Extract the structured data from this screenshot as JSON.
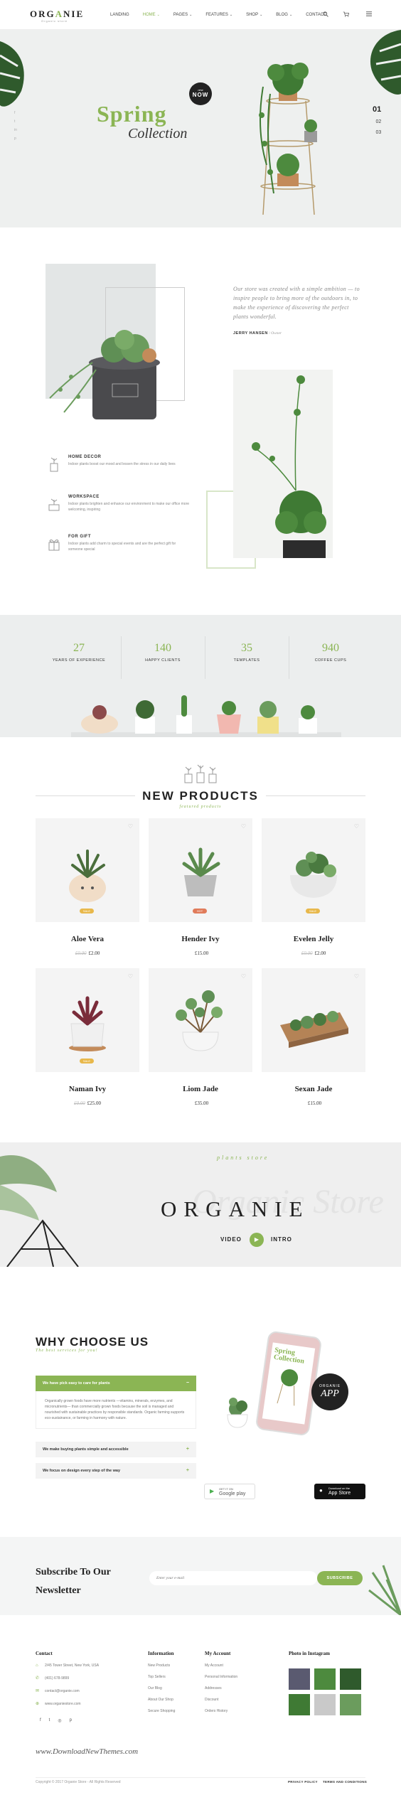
{
  "header": {
    "logo": "ORGANIE",
    "logo_sub": "Organic store",
    "nav": [
      {
        "label": "LANDING",
        "caret": ""
      },
      {
        "label": "HOME",
        "caret": "⌄"
      },
      {
        "label": "PAGES",
        "caret": "⌄"
      },
      {
        "label": "FEATURES",
        "caret": "⌄"
      },
      {
        "label": "SHOP",
        "caret": "⌄"
      },
      {
        "label": "BLOG",
        "caret": "⌄"
      },
      {
        "label": "CONTACT",
        "caret": ""
      }
    ],
    "search_icon": "⌕",
    "cart_icon": "🛒",
    "menu_icon": "≡"
  },
  "hero": {
    "title": "Spring",
    "subtitle": "Collection",
    "badge_small": "new",
    "badge_big": "NOW",
    "slides": [
      "01",
      "02",
      "03"
    ],
    "social": [
      "f",
      "t",
      "in",
      "p"
    ]
  },
  "about": {
    "quote": "Our store was created with a simple ambition — to inspire people to bring more of the outdoors in, to make the experience of discovering the perfect plants wonderful.",
    "author_name": "JERRY HANSEN",
    "author_role": " / Owner",
    "features": [
      {
        "title": "HOME DECOR",
        "text": "Indoor plants boost our mood and lessen the stress in our daily lives"
      },
      {
        "title": "WORKSPACE",
        "text": "Indoor plants brighten and enhance our environment to make our office more welcoming, inspiring"
      },
      {
        "title": "FOR GIFT",
        "text": "Indoor plants add charm to special events and are the perfect gift for someone special"
      }
    ]
  },
  "stats": [
    {
      "num": "27",
      "label": "YEARS OF EXPERIENCE"
    },
    {
      "num": "140",
      "label": "HAPPY CLIENTS"
    },
    {
      "num": "35",
      "label": "TEMPLATES"
    },
    {
      "num": "940",
      "label": "COFFEE CUPS"
    }
  ],
  "products_section": {
    "title": "NEW PRODUCTS",
    "subtitle": "featured products",
    "items": [
      {
        "name": "Aloe Vera",
        "old_price": "£0.00",
        "price": "£2.00",
        "badge": "SALE",
        "badge_color": "#e8b84b"
      },
      {
        "name": "Hender Ivy",
        "old_price": "",
        "price": "£15.00",
        "badge": "HOT",
        "badge_color": "#e07b5a"
      },
      {
        "name": "Evelen Jelly",
        "old_price": "£0.00",
        "price": "£2.00",
        "badge": "SALE",
        "badge_color": "#e8b84b"
      },
      {
        "name": "Naman Ivy",
        "old_price": "£0.00",
        "price": "£25.00",
        "badge": "SALE",
        "badge_color": "#e8b84b"
      },
      {
        "name": "Liom Jade",
        "old_price": "",
        "price": "£35.00",
        "badge": "",
        "badge_color": ""
      },
      {
        "name": "Sexan Jade",
        "old_price": "",
        "price": "£15.00",
        "badge": "",
        "badge_color": ""
      }
    ]
  },
  "banner": {
    "store": "plants store",
    "title": "ORGANIE",
    "script": "Organic Store",
    "video": "VIDEO",
    "intro": "INTRO",
    "play_icon": "▶"
  },
  "why": {
    "title": "WHY CHOOSE US",
    "subtitle": "The best services for you!",
    "accordion": [
      {
        "head": "We have pick easy to care for plants",
        "body": "Organically grown foods have more nutrients —vitamins, minerals, enzymes, and micronutrients— than commercially grown foods because the soil is managed and nourished with sustainable practices by responsible standards. Organic farming supports eco-sustainance, or farming in harmony with nature.",
        "sign": "−"
      },
      {
        "head": "We make buying plants simple and accessible",
        "sign": "+"
      },
      {
        "head": "We focus on design every step of the way",
        "sign": "+"
      }
    ],
    "phone_title": "Spring Collection",
    "app_small": "ORGANIE",
    "app_big": "APP",
    "google_small": "GET IT ON",
    "google": "Google play",
    "apple_small": "Download on the",
    "apple": "App Store"
  },
  "newsletter": {
    "title_line1": "Subscribe To Our",
    "title_line2": "Newsletter",
    "placeholder": "Enter your e-mail",
    "button": "SUBSCRIBE"
  },
  "footer": {
    "contact_head": "Contact",
    "contact": [
      {
        "icon": "⌂",
        "text": "2/45 Tower Street, New York, USA"
      },
      {
        "icon": "✆",
        "text": "(401) 678-9899"
      },
      {
        "icon": "✉",
        "text": "contact@organie.com"
      },
      {
        "icon": "⊕",
        "text": "www.organiestore.com"
      }
    ],
    "info_head": "Information",
    "info": [
      "New Products",
      "Top Sellers",
      "Our Blog",
      "About Our Shop",
      "Secure Shopping"
    ],
    "account_head": "My Account",
    "account": [
      "My Account",
      "Personal Information",
      "Addresses",
      "Discount",
      "Orders History"
    ],
    "insta_head": "Photo in Instagram",
    "social": [
      "f",
      "t",
      "◎",
      "p"
    ],
    "watermark": "www.DownloadNewThemes.com",
    "copyright": "Copyright © 2017 Organie Store - All Rights Reserved",
    "privacy": "PRIVACY POLICY",
    "terms": "TERMS AND CONDITIONS"
  },
  "colors": {
    "accent": "#8bb554",
    "dark": "#222222"
  }
}
